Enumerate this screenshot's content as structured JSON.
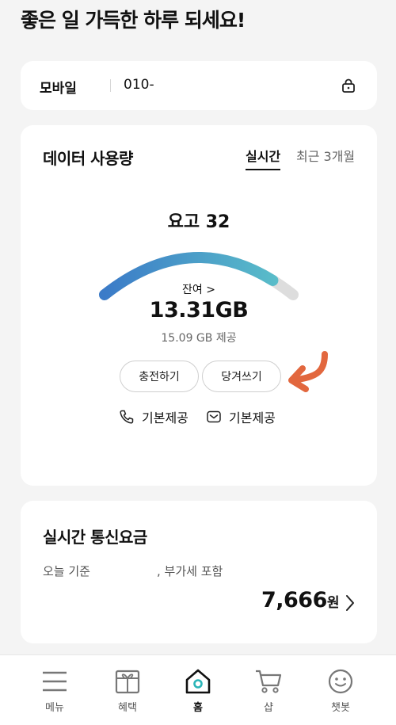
{
  "greeting": "좋은 일 가득한 하루 되세요!",
  "line": {
    "type": "모바일",
    "number": "010-"
  },
  "data_usage": {
    "title": "데이터 사용량",
    "tabs": [
      {
        "label": "실시간",
        "active": true
      },
      {
        "label": "최근 3개월",
        "active": false
      }
    ],
    "plan_name": "요고 32",
    "remaining_label": "잔여 >",
    "remaining_value": "13.31GB",
    "provided": "15.09 GB 제공",
    "remaining_ratio": 0.88,
    "buttons": {
      "charge": "충전하기",
      "pull": "당겨쓰기"
    },
    "voice": {
      "icon": "phone-icon",
      "label": "기본제공"
    },
    "sms": {
      "icon": "message-icon",
      "label": "기본제공"
    },
    "gauge_colors": {
      "start": "#3b7bc8",
      "end": "#5cc3c9",
      "empty": "#dddddd"
    },
    "annotation_arrow_color": "#e2673e"
  },
  "bill": {
    "title": "실시간 통신요금",
    "basis": "오늘 기준",
    "vat_note": ", 부가세 포함",
    "amount": "7,666",
    "unit": "원"
  },
  "nav": [
    {
      "label": "메뉴",
      "icon": "menu-icon",
      "active": false
    },
    {
      "label": "혜택",
      "icon": "gift-icon",
      "active": false
    },
    {
      "label": "홈",
      "icon": "home-icon",
      "active": true
    },
    {
      "label": "샵",
      "icon": "cart-icon",
      "active": false
    },
    {
      "label": "챗봇",
      "icon": "chatbot-icon",
      "active": false
    }
  ],
  "accent_color": "#2bb5b8"
}
